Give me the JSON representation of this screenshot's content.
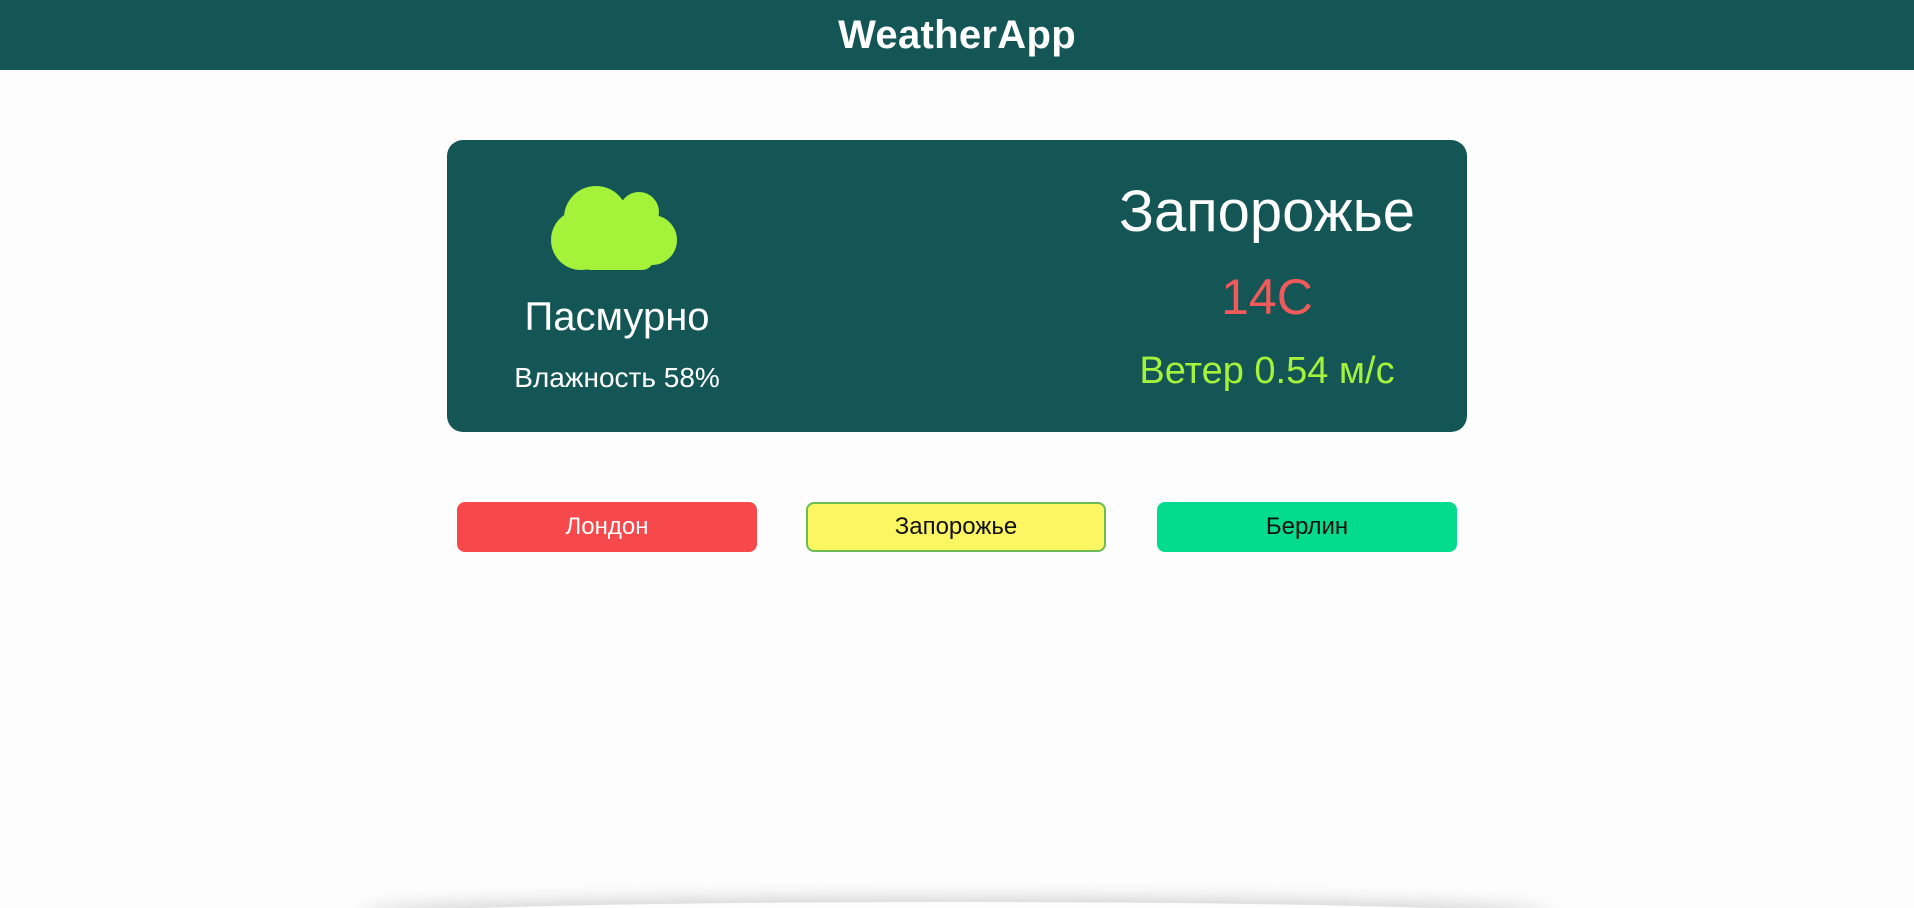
{
  "header": {
    "title": "WeatherApp"
  },
  "weather": {
    "icon": "cloud-icon",
    "condition": "Пасмурно",
    "humidity": "Влажность 58%",
    "city": "Запорожье",
    "temperature": "14C",
    "wind": "Ветер 0.54 м/с"
  },
  "cities": [
    {
      "label": "Лондон",
      "color": "#f7484c"
    },
    {
      "label": "Запорожье",
      "color": "#fbf662"
    },
    {
      "label": "Берлин",
      "color": "#03dc8c"
    }
  ],
  "colors": {
    "primary": "#145656",
    "cloud": "#a4f23a",
    "temperature": "#f05a5a",
    "wind": "#a4f23a"
  }
}
